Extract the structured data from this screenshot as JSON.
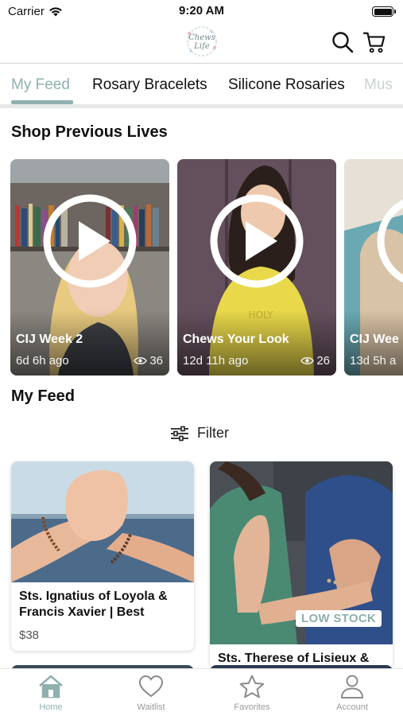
{
  "status_bar": {
    "carrier": "Carrier",
    "time": "9:20 AM"
  },
  "header": {
    "logo_text": "Chews Life",
    "icons": [
      "search-icon",
      "cart-icon"
    ]
  },
  "tabs": [
    {
      "label": "My Feed",
      "active": true
    },
    {
      "label": "Rosary Bracelets",
      "active": false
    },
    {
      "label": "Silicone Rosaries",
      "active": false
    },
    {
      "label": "Mus",
      "active": false
    }
  ],
  "shop_previous_lives": {
    "title": "Shop Previous Lives",
    "cards": [
      {
        "title": "CIJ Week 2",
        "age": "6d 6h ago",
        "views": "36"
      },
      {
        "title": "Chews Your Look",
        "age": "12d 11h ago",
        "views": "26"
      },
      {
        "title": "CIJ Wee",
        "age": "13d 5h a",
        "views": ""
      }
    ]
  },
  "my_feed": {
    "title": "My Feed",
    "filter_label": "Filter",
    "products": [
      {
        "name": "Sts. Ignatius of Loyola & Francis Xavier | Best",
        "price": "$38",
        "badge": ""
      },
      {
        "name": "Sts. Therese of Lisieux &",
        "price": "",
        "badge": "LOW STOCK"
      }
    ]
  },
  "bottom_nav": [
    {
      "label": "Home",
      "icon": "home-icon",
      "active": true
    },
    {
      "label": "Waitlist",
      "icon": "heart-icon",
      "active": false
    },
    {
      "label": "Favorites",
      "icon": "star-icon",
      "active": false
    },
    {
      "label": "Account",
      "icon": "person-icon",
      "active": false
    }
  ],
  "colors": {
    "accent": "#8fb0ae",
    "text": "#111111",
    "muted": "#9a9a9a"
  }
}
